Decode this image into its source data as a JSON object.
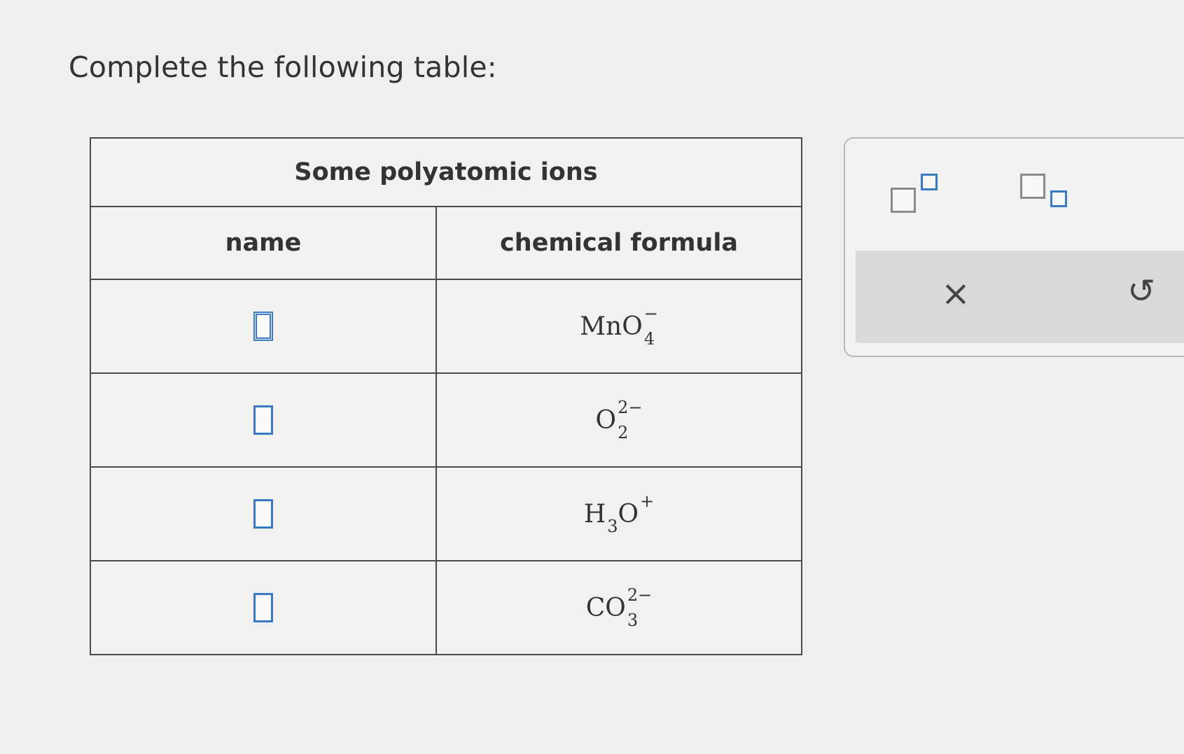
{
  "prompt": "Complete the following table:",
  "table": {
    "caption": "Some polyatomic ions",
    "headers": {
      "name": "name",
      "formula": "chemical formula"
    },
    "rows": [
      {
        "name_value": "",
        "base": "MnO",
        "sub": "4",
        "charge": "−"
      },
      {
        "name_value": "",
        "base": "O",
        "sub": "2",
        "charge": "2−"
      },
      {
        "name_value": "",
        "base": "H",
        "mid_sub": "3",
        "tail": "O",
        "charge": "+"
      },
      {
        "name_value": "",
        "base": "CO",
        "sub": "3",
        "charge": "2−"
      }
    ]
  },
  "tools": {
    "clear_glyph": "×",
    "undo_glyph": "↺"
  },
  "colors": {
    "accent": "#3a79c4",
    "background": "#efefef",
    "tool_bar": "#d9d9d9"
  }
}
